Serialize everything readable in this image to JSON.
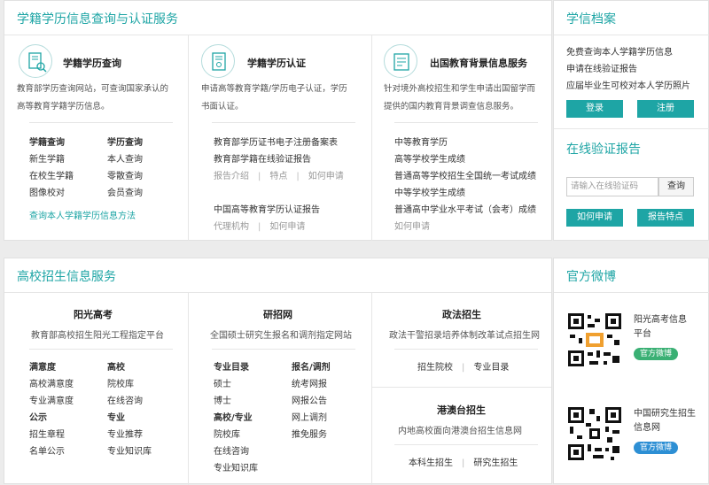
{
  "xueji": {
    "title": "学籍学历信息查询与认证服务",
    "col1": {
      "title": "学籍学历查询",
      "desc": [
        "教育部学历查询网站，可查询国家承认的",
        "高等教育学籍学历信息。"
      ],
      "group1": {
        "head": "学籍查询",
        "items": [
          "新生学籍",
          "在校生学籍",
          "图像校对"
        ]
      },
      "group2": {
        "head": "学历查询",
        "items": [
          "本人查询",
          "零散查询",
          "会员查询"
        ]
      },
      "link": "查询本人学籍学历信息方法"
    },
    "col2": {
      "title": "学籍学历认证",
      "desc": [
        "申请高等教育学籍/学历电子认证，学历",
        "书面认证。"
      ],
      "items": [
        "教育部学历证书电子注册备案表",
        "教育部学籍在线验证报告"
      ],
      "sub1": [
        "报告介绍",
        "特点",
        "如何申请"
      ],
      "item3": "中国高等教育学历认证报告",
      "sub2": [
        "代理机构",
        "如何申请"
      ]
    },
    "col3": {
      "title": "出国教育背景信息服务",
      "desc": [
        "针对境外高校招生和学生申请出国留学而",
        "提供的国内教育背景调查信息服务。"
      ],
      "items": [
        "中等教育学历",
        "高等学校学生成绩",
        "普通高等学校招生全国统一考试成绩",
        "中等学校学生成绩",
        "普通高中学业水平考试（会考）成绩"
      ],
      "tail": "如何申请"
    }
  },
  "dangan": {
    "title": "学信档案",
    "lines": [
      "免费查询本人学籍学历信息",
      "申请在线验证报告",
      "应届毕业生可校对本人学历照片"
    ],
    "login": "登录",
    "register": "注册"
  },
  "verify": {
    "title": "在线验证报告",
    "placeholder": "请输入在线验证码",
    "query": "查询",
    "how": "如何申请",
    "features": "报告特点"
  },
  "zhaosheng": {
    "title": "高校招生信息服务",
    "yangguang": {
      "title": "阳光高考",
      "desc": "教育部高校招生阳光工程指定平台",
      "a": {
        "head": "满意度",
        "items": [
          "高校满意度",
          "专业满意度"
        ]
      },
      "b": {
        "head": "高校",
        "items": [
          "院校库",
          "在线咨询"
        ]
      },
      "c": {
        "head": "公示",
        "items": [
          "招生章程",
          "名单公示"
        ]
      },
      "d": {
        "head": "专业",
        "items": [
          "专业推荐",
          "专业知识库"
        ]
      }
    },
    "yanzhao": {
      "title": "研招网",
      "desc": "全国硕士研究生报名和调剂指定网站",
      "a": {
        "head": "专业目录",
        "items": [
          "硕士",
          "博士"
        ]
      },
      "b": {
        "head": "报名/调剂",
        "items": [
          "统考网报",
          "网报公告",
          "网上调剂",
          "推免服务"
        ]
      },
      "c": {
        "head": "高校/专业",
        "items": [
          "院校库",
          "在线咨询",
          "专业知识库"
        ]
      }
    },
    "zhengfa": {
      "title": "政法招生",
      "desc": "政法干警招录培养体制改革试点招生网",
      "links": [
        "招生院校",
        "专业目录"
      ]
    },
    "gangao": {
      "title": "港澳台招生",
      "desc": "内地高校面向港澳台招生信息网",
      "links": [
        "本科生招生",
        "研究生招生"
      ]
    }
  },
  "weibo": {
    "title": "官方微博",
    "w1": {
      "name": [
        "阳光高考信息",
        "平台"
      ],
      "badge": "官方微博"
    },
    "w2": {
      "name": [
        "中国研究生招生",
        "信息网"
      ],
      "badge": "官方微博"
    }
  },
  "colors": {
    "accent": "#1ea5a5",
    "green": "#3ab074",
    "blue": "#2d8fd4"
  },
  "icons": [
    "certificate-search-icon",
    "certificate-verify-icon",
    "document-icon",
    "qr-code-icon"
  ]
}
